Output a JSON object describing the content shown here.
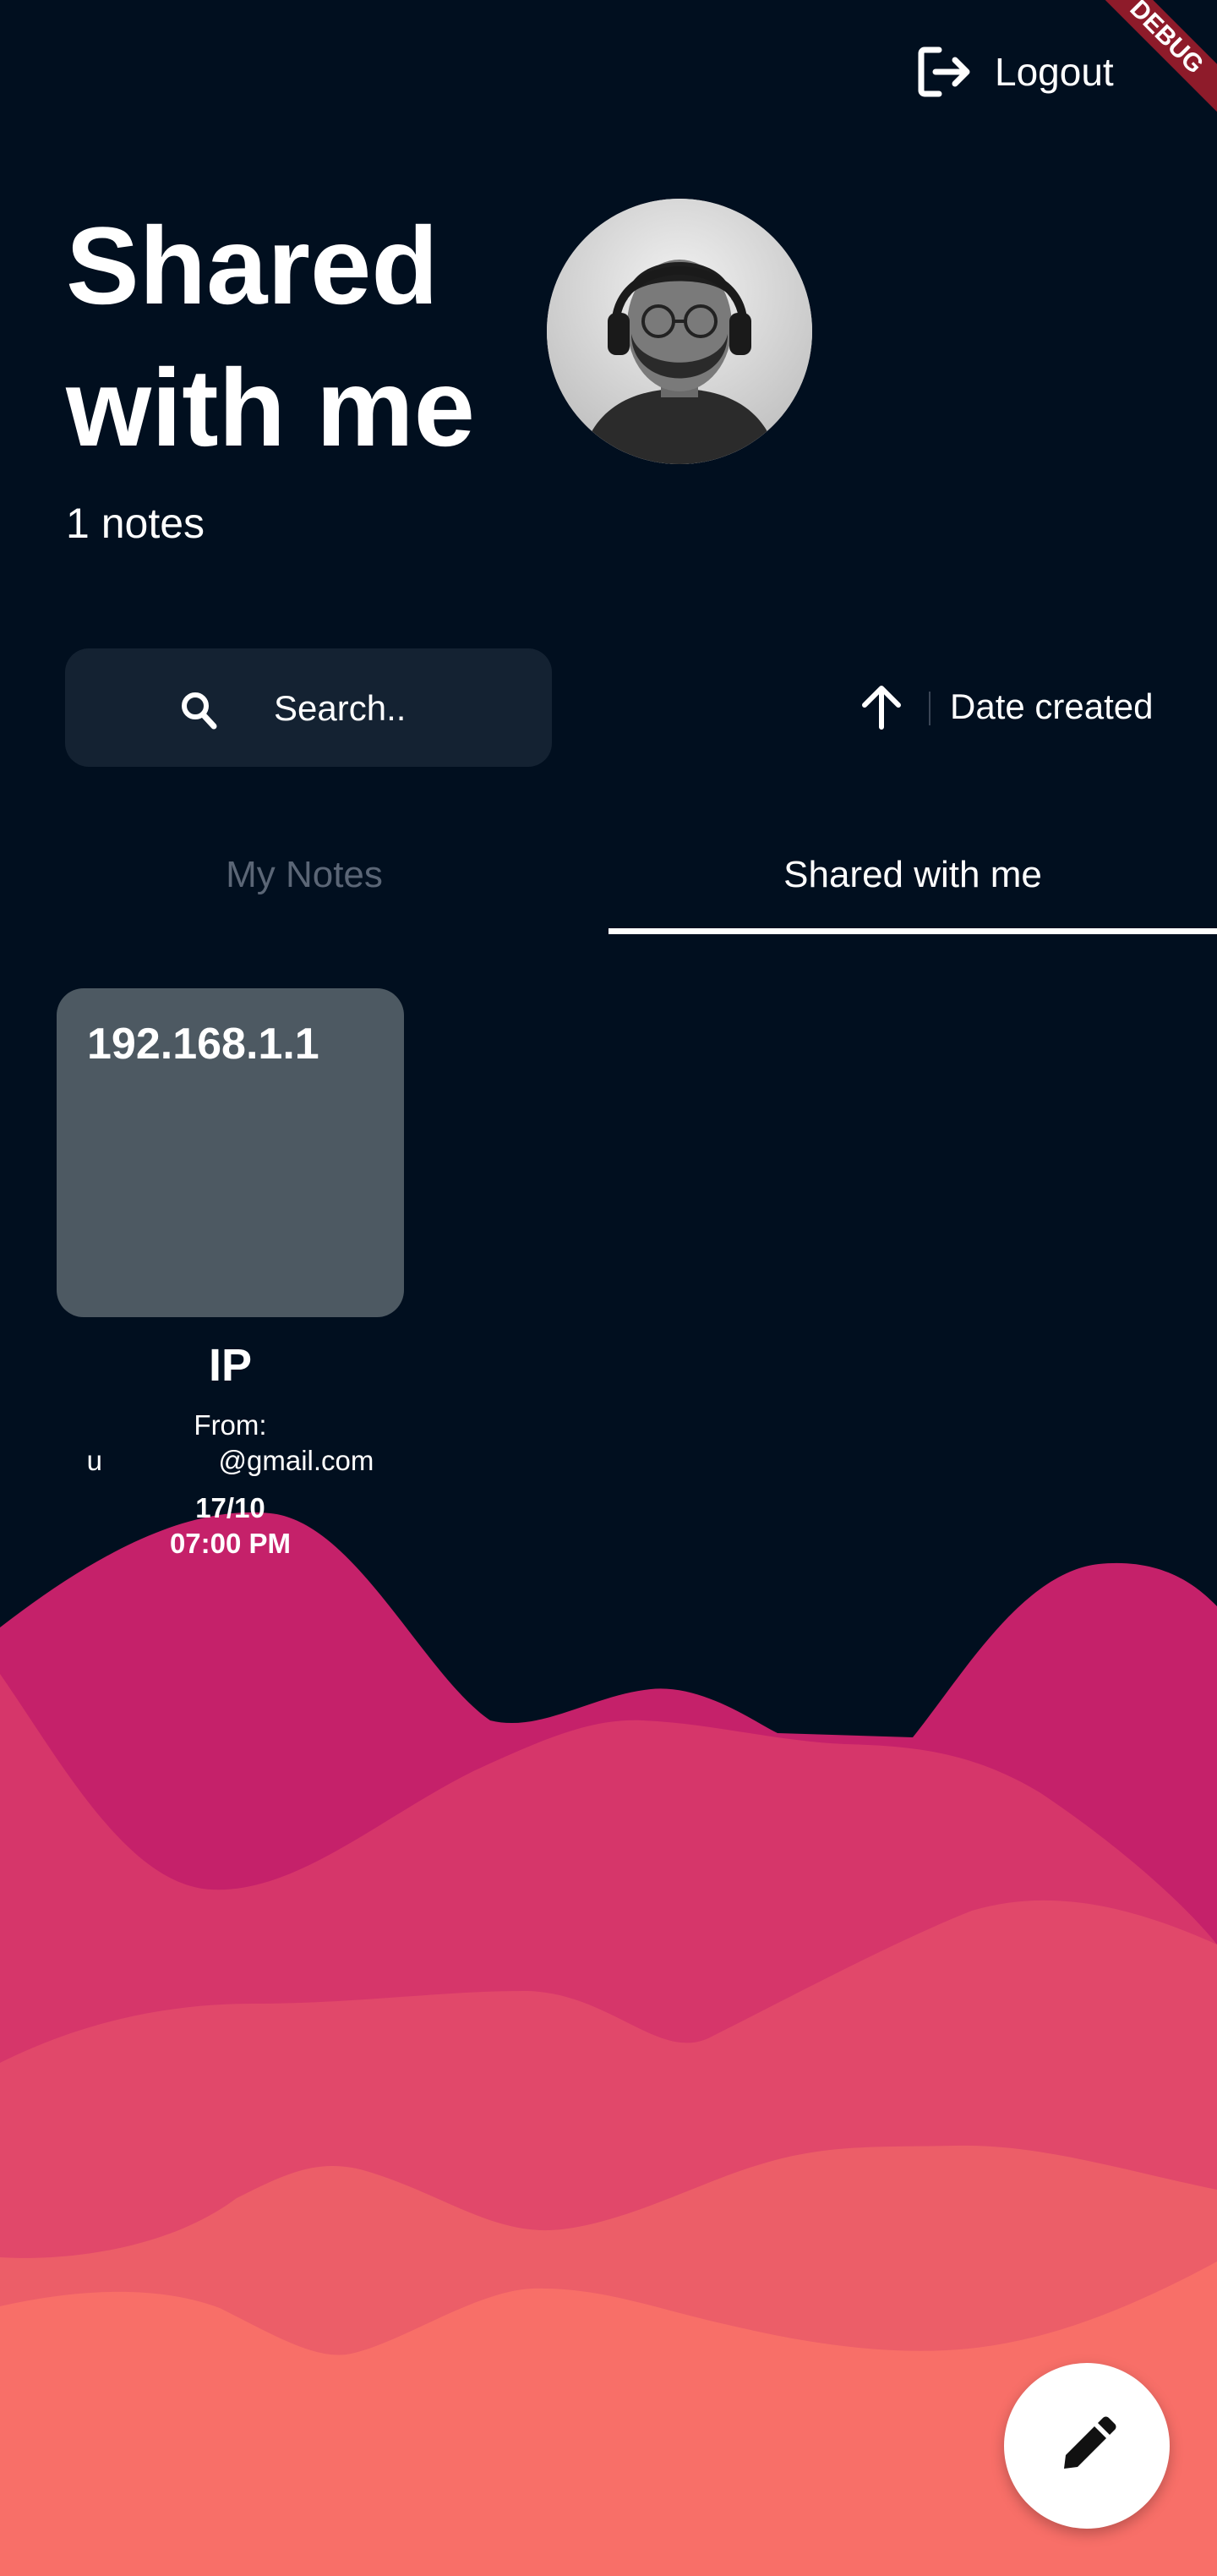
{
  "debug_banner": "DEBUG",
  "header": {
    "logout_label": "Logout"
  },
  "page": {
    "title": "Shared with me",
    "note_count": "1 notes"
  },
  "search": {
    "placeholder": "Search.."
  },
  "sort": {
    "label": "Date created",
    "direction": "ascending"
  },
  "tabs": [
    {
      "label": "My Notes",
      "active": false
    },
    {
      "label": "Shared with me",
      "active": true
    }
  ],
  "notes": [
    {
      "content": "192.168.1.1",
      "title": "IP",
      "from_label": "From:",
      "from_email": "u               @gmail.com",
      "date": "17/10",
      "time": "07:00 PM"
    }
  ],
  "icons": {
    "logout": "logout-icon",
    "search": "search-icon",
    "sort": "arrow-up-icon",
    "fab": "pencil-icon"
  },
  "colors": {
    "background": "#010f1f",
    "search_bg": "#142232",
    "card_bg": "#4d5962",
    "tab_inactive": "#5b6676",
    "wave_1": "#c5216a",
    "wave_2": "#d6366a",
    "wave_3": "#e1486a",
    "wave_4": "#ec5e68",
    "wave_5": "#f86f68"
  }
}
